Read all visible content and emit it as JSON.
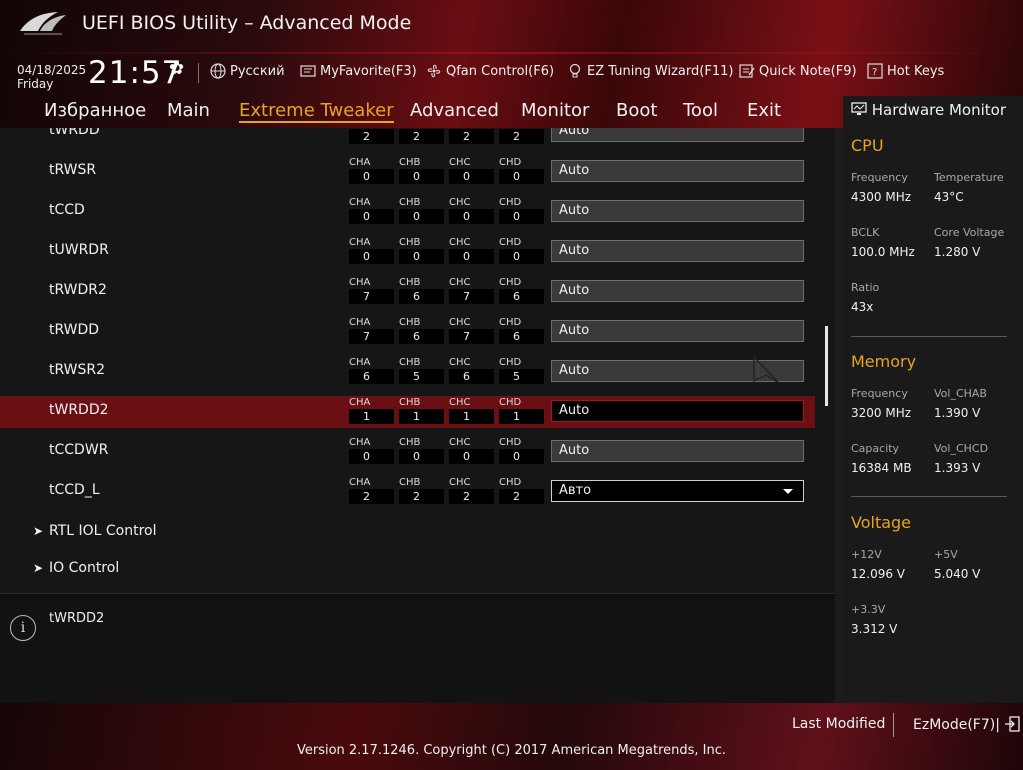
{
  "header": {
    "title": "UEFI BIOS Utility – Advanced Mode",
    "date": "04/18/2025",
    "day": "Friday",
    "time": "21:57"
  },
  "toolbar": {
    "language": "Русский",
    "myfavorite": "MyFavorite(F3)",
    "qfan": "Qfan Control(F6)",
    "ez_tuning": "EZ Tuning Wizard(F11)",
    "quick_note": "Quick Note(F9)",
    "hot_keys": "Hot Keys"
  },
  "menu": {
    "items": [
      "Избранное",
      "Main",
      "Extreme Tweaker",
      "Advanced",
      "Monitor",
      "Boot",
      "Tool",
      "Exit"
    ],
    "active": "Extreme Tweaker"
  },
  "channels": [
    "CHA",
    "CHB",
    "CHC",
    "CHD"
  ],
  "rows": [
    {
      "label": "tWRDD",
      "values": [
        "2",
        "2",
        "2",
        "2"
      ],
      "setting": "Auto"
    },
    {
      "label": "tRWSR",
      "values": [
        "0",
        "0",
        "0",
        "0"
      ],
      "setting": "Auto"
    },
    {
      "label": "tCCD",
      "values": [
        "0",
        "0",
        "0",
        "0"
      ],
      "setting": "Auto"
    },
    {
      "label": "tUWRDR",
      "values": [
        "0",
        "0",
        "0",
        "0"
      ],
      "setting": "Auto"
    },
    {
      "label": "tRWDR2",
      "values": [
        "7",
        "6",
        "7",
        "6"
      ],
      "setting": "Auto"
    },
    {
      "label": "tRWDD",
      "values": [
        "7",
        "6",
        "7",
        "6"
      ],
      "setting": "Auto"
    },
    {
      "label": "tRWSR2",
      "values": [
        "6",
        "5",
        "6",
        "5"
      ],
      "setting": "Auto"
    },
    {
      "label": "tWRDD2",
      "values": [
        "1",
        "1",
        "1",
        "1"
      ],
      "setting": "Auto"
    },
    {
      "label": "tCCDWR",
      "values": [
        "0",
        "0",
        "0",
        "0"
      ],
      "setting": "Auto"
    },
    {
      "label": "tCCD_L",
      "values": [
        "2",
        "2",
        "2",
        "2"
      ],
      "setting": "Авто"
    }
  ],
  "submenus": [
    "RTL IOL Control",
    "IO Control"
  ],
  "help": {
    "text": "tWRDD2"
  },
  "hw_monitor": {
    "title": "Hardware Monitor",
    "cpu": {
      "heading": "CPU",
      "frequency_label": "Frequency",
      "frequency": "4300 MHz",
      "temperature_label": "Temperature",
      "temperature": "43°C",
      "bclk_label": "BCLK",
      "bclk": "100.0 MHz",
      "core_voltage_label": "Core Voltage",
      "core_voltage": "1.280 V",
      "ratio_label": "Ratio",
      "ratio": "43x"
    },
    "memory": {
      "heading": "Memory",
      "frequency_label": "Frequency",
      "frequency": "3200 MHz",
      "vol_chab_label": "Vol_CHAB",
      "vol_chab": "1.390 V",
      "capacity_label": "Capacity",
      "capacity": "16384 MB",
      "vol_chcd_label": "Vol_CHCD",
      "vol_chcd": "1.393 V"
    },
    "voltage": {
      "heading": "Voltage",
      "v12_label": "+12V",
      "v12": "12.096 V",
      "v5_label": "+5V",
      "v5": "5.040 V",
      "v33_label": "+3.3V",
      "v33": "3.312 V"
    }
  },
  "footer": {
    "last_modified": "Last Modified",
    "ezmode": "EzMode(F7)|",
    "version": "Version 2.17.1246. Copyright (C) 2017 American Megatrends, Inc."
  },
  "colors": {
    "accent": "#e8a323",
    "selected_row": "#6a0f14",
    "brand_red": "#b0151c"
  }
}
